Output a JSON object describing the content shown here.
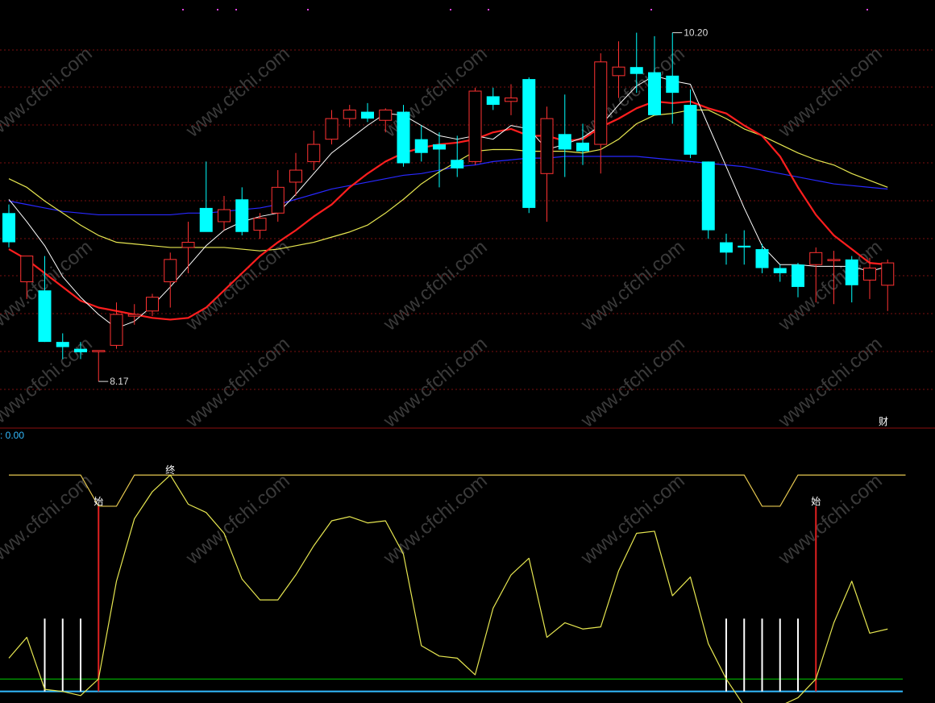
{
  "indicator_value": ": 0.00",
  "badge": "财",
  "colors": {
    "bg": "#000000",
    "up": "#ff3232",
    "down": "#00ffff",
    "ma_white": "#ffffff",
    "ma_red": "#ff1e1e",
    "ma_yellow": "#e6e650",
    "ma_blue": "#2828ff",
    "osc": "#e6e650",
    "upper_band": "#e6c850",
    "signal_red": "#e02020",
    "level_green": "#00d000",
    "level_blue": "#33bbff",
    "grid": "#7a1010",
    "label": "#dddddd"
  },
  "watermark_text": "www.cfchi.com",
  "chart_data": [
    {
      "type": "candlestick",
      "ylim": [
        7.95,
        10.32
      ],
      "grid": true,
      "annotations": [
        {
          "text": "10.20",
          "bar": 37,
          "price": 10.2
        },
        {
          "text": "8.17",
          "bar": 5,
          "price": 8.17
        }
      ],
      "candles": [
        {
          "o": 9.15,
          "h": 9.2,
          "l": 8.95,
          "c": 8.98
        },
        {
          "o": 8.75,
          "h": 8.9,
          "l": 8.65,
          "c": 8.9
        },
        {
          "o": 8.7,
          "h": 8.9,
          "l": 8.4,
          "c": 8.4
        },
        {
          "o": 8.4,
          "h": 8.45,
          "l": 8.3,
          "c": 8.37
        },
        {
          "o": 8.36,
          "h": 8.4,
          "l": 8.3,
          "c": 8.34
        },
        {
          "o": 8.35,
          "h": 8.35,
          "l": 8.17,
          "c": 8.35
        },
        {
          "o": 8.38,
          "h": 8.63,
          "l": 8.36,
          "c": 8.56
        },
        {
          "o": 8.55,
          "h": 8.62,
          "l": 8.5,
          "c": 8.56
        },
        {
          "o": 8.58,
          "h": 8.68,
          "l": 8.55,
          "c": 8.66
        },
        {
          "o": 8.75,
          "h": 8.92,
          "l": 8.6,
          "c": 8.88
        },
        {
          "o": 8.95,
          "h": 9.1,
          "l": 8.8,
          "c": 8.98
        },
        {
          "o": 9.18,
          "h": 9.45,
          "l": 9.05,
          "c": 9.04
        },
        {
          "o": 9.1,
          "h": 9.25,
          "l": 9.05,
          "c": 9.17
        },
        {
          "o": 9.23,
          "h": 9.3,
          "l": 9.02,
          "c": 9.04
        },
        {
          "o": 9.05,
          "h": 9.15,
          "l": 9.0,
          "c": 9.12
        },
        {
          "o": 9.15,
          "h": 9.4,
          "l": 9.1,
          "c": 9.3
        },
        {
          "o": 9.33,
          "h": 9.5,
          "l": 9.25,
          "c": 9.4
        },
        {
          "o": 9.45,
          "h": 9.63,
          "l": 9.4,
          "c": 9.55
        },
        {
          "o": 9.58,
          "h": 9.75,
          "l": 9.55,
          "c": 9.7
        },
        {
          "o": 9.7,
          "h": 9.78,
          "l": 9.65,
          "c": 9.75
        },
        {
          "o": 9.74,
          "h": 9.79,
          "l": 9.68,
          "c": 9.7
        },
        {
          "o": 9.69,
          "h": 9.76,
          "l": 9.62,
          "c": 9.75
        },
        {
          "o": 9.74,
          "h": 9.78,
          "l": 9.42,
          "c": 9.44
        },
        {
          "o": 9.58,
          "h": 9.66,
          "l": 9.45,
          "c": 9.5
        },
        {
          "o": 9.55,
          "h": 9.62,
          "l": 9.3,
          "c": 9.52
        },
        {
          "o": 9.46,
          "h": 9.6,
          "l": 9.36,
          "c": 9.41
        },
        {
          "o": 9.45,
          "h": 9.88,
          "l": 9.43,
          "c": 9.86
        },
        {
          "o": 9.83,
          "h": 9.88,
          "l": 9.75,
          "c": 9.78
        },
        {
          "o": 9.8,
          "h": 9.9,
          "l": 9.72,
          "c": 9.82
        },
        {
          "o": 9.93,
          "h": 9.94,
          "l": 9.15,
          "c": 9.18
        },
        {
          "o": 9.38,
          "h": 9.77,
          "l": 9.1,
          "c": 9.7
        },
        {
          "o": 9.61,
          "h": 9.84,
          "l": 9.36,
          "c": 9.52
        },
        {
          "o": 9.56,
          "h": 9.67,
          "l": 9.43,
          "c": 9.51
        },
        {
          "o": 9.55,
          "h": 10.08,
          "l": 9.38,
          "c": 10.03
        },
        {
          "o": 9.95,
          "h": 10.15,
          "l": 9.82,
          "c": 10.0
        },
        {
          "o": 10.0,
          "h": 10.2,
          "l": 9.85,
          "c": 9.96
        },
        {
          "o": 9.97,
          "h": 10.18,
          "l": 9.75,
          "c": 9.72
        },
        {
          "o": 9.95,
          "h": 10.2,
          "l": 9.67,
          "c": 9.85
        },
        {
          "o": 9.78,
          "h": 9.87,
          "l": 9.47,
          "c": 9.49
        },
        {
          "o": 9.45,
          "h": 9.45,
          "l": 9.0,
          "c": 9.05
        },
        {
          "o": 8.98,
          "h": 9.03,
          "l": 8.85,
          "c": 8.92
        },
        {
          "o": 8.96,
          "h": 9.05,
          "l": 8.85,
          "c": 8.95
        },
        {
          "o": 8.94,
          "h": 8.97,
          "l": 8.8,
          "c": 8.83
        },
        {
          "o": 8.83,
          "h": 8.85,
          "l": 8.75,
          "c": 8.8
        },
        {
          "o": 8.85,
          "h": 8.86,
          "l": 8.66,
          "c": 8.72
        },
        {
          "o": 8.85,
          "h": 8.95,
          "l": 8.63,
          "c": 8.92
        },
        {
          "o": 8.88,
          "h": 8.93,
          "l": 8.62,
          "c": 8.88
        },
        {
          "o": 8.88,
          "h": 8.9,
          "l": 8.63,
          "c": 8.73
        },
        {
          "o": 8.76,
          "h": 8.89,
          "l": 8.65,
          "c": 8.83
        },
        {
          "o": 8.73,
          "h": 8.88,
          "l": 8.58,
          "c": 8.86
        }
      ],
      "ma_white": [
        9.23,
        9.1,
        8.96,
        8.78,
        8.66,
        8.56,
        8.48,
        8.52,
        8.61,
        8.72,
        8.84,
        8.96,
        9.05,
        9.1,
        9.13,
        9.15,
        9.26,
        9.38,
        9.5,
        9.58,
        9.66,
        9.73,
        9.72,
        9.66,
        9.6,
        9.58,
        9.6,
        9.58,
        9.66,
        9.64,
        9.52,
        9.55,
        9.59,
        9.66,
        9.78,
        9.89,
        9.95,
        9.92,
        9.9,
        9.66,
        9.42,
        9.18,
        8.96,
        8.85,
        8.85,
        8.84,
        8.84,
        8.84,
        8.81,
        8.84
      ],
      "ma_red": [
        8.94,
        8.88,
        8.8,
        8.72,
        8.64,
        8.6,
        8.58,
        8.56,
        8.54,
        8.53,
        8.54,
        8.6,
        8.7,
        8.8,
        8.9,
        8.98,
        9.05,
        9.13,
        9.2,
        9.3,
        9.38,
        9.45,
        9.5,
        9.53,
        9.55,
        9.56,
        9.58,
        9.62,
        9.64,
        9.6,
        9.6,
        9.57,
        9.58,
        9.65,
        9.7,
        9.76,
        9.8,
        9.79,
        9.8,
        9.76,
        9.73,
        9.66,
        9.6,
        9.48,
        9.3,
        9.14,
        9.02,
        8.94,
        8.86,
        8.85
      ],
      "ma_yellow": [
        9.35,
        9.3,
        9.22,
        9.15,
        9.08,
        9.02,
        8.98,
        8.97,
        8.96,
        8.95,
        8.95,
        8.95,
        8.95,
        8.94,
        8.93,
        8.94,
        8.96,
        8.98,
        9.01,
        9.04,
        9.08,
        9.15,
        9.23,
        9.32,
        9.39,
        9.45,
        9.51,
        9.52,
        9.52,
        9.51,
        9.51,
        9.51,
        9.5,
        9.52,
        9.58,
        9.67,
        9.72,
        9.73,
        9.75,
        9.75,
        9.7,
        9.64,
        9.6,
        9.55,
        9.5,
        9.46,
        9.43,
        9.38,
        9.34,
        9.3
      ],
      "ma_blue": [
        9.22,
        9.2,
        9.18,
        9.16,
        9.15,
        9.14,
        9.14,
        9.14,
        9.14,
        9.14,
        9.15,
        9.15,
        9.16,
        9.17,
        9.18,
        9.2,
        9.23,
        9.26,
        9.29,
        9.31,
        9.33,
        9.35,
        9.37,
        9.38,
        9.4,
        9.42,
        9.43,
        9.45,
        9.46,
        9.47,
        9.47,
        9.48,
        9.48,
        9.48,
        9.48,
        9.48,
        9.47,
        9.46,
        9.45,
        9.44,
        9.43,
        9.42,
        9.4,
        9.38,
        9.36,
        9.34,
        9.32,
        9.31,
        9.3,
        9.29
      ]
    },
    {
      "type": "line",
      "ylim": [
        -2,
        115
      ],
      "level_lines": [
        8,
        2
      ],
      "series": [
        {
          "values": [
            18,
            28,
            3,
            2,
            0,
            8,
            55,
            85,
            98,
            106,
            92,
            88,
            78,
            56,
            46,
            46,
            58,
            72,
            84,
            86,
            83,
            84,
            68,
            24,
            19,
            18,
            10,
            42,
            58,
            66,
            28,
            35,
            32,
            33,
            60,
            78,
            79,
            48,
            57,
            25,
            8,
            -5,
            -5,
            -5,
            -1,
            8,
            35,
            55,
            30,
            32
          ]
        }
      ],
      "upper_band": [
        106,
        106,
        106,
        106,
        106,
        91,
        91,
        106,
        106,
        106,
        106,
        106,
        106,
        106,
        106,
        106,
        106,
        106,
        106,
        106,
        106,
        106,
        106,
        106,
        106,
        106,
        106,
        106,
        106,
        106,
        106,
        106,
        106,
        106,
        106,
        106,
        106,
        106,
        106,
        106,
        106,
        106,
        91,
        91,
        106,
        106,
        106,
        106,
        106,
        106,
        106
      ],
      "markers": [
        {
          "text": "始",
          "bar": 5
        },
        {
          "text": "终",
          "bar": 9
        },
        {
          "text": "始",
          "bar": 45
        }
      ],
      "signal_bars_red": [
        5,
        45
      ],
      "signal_bars_white": [
        2,
        3,
        4,
        40,
        41,
        42,
        43,
        44
      ]
    }
  ]
}
